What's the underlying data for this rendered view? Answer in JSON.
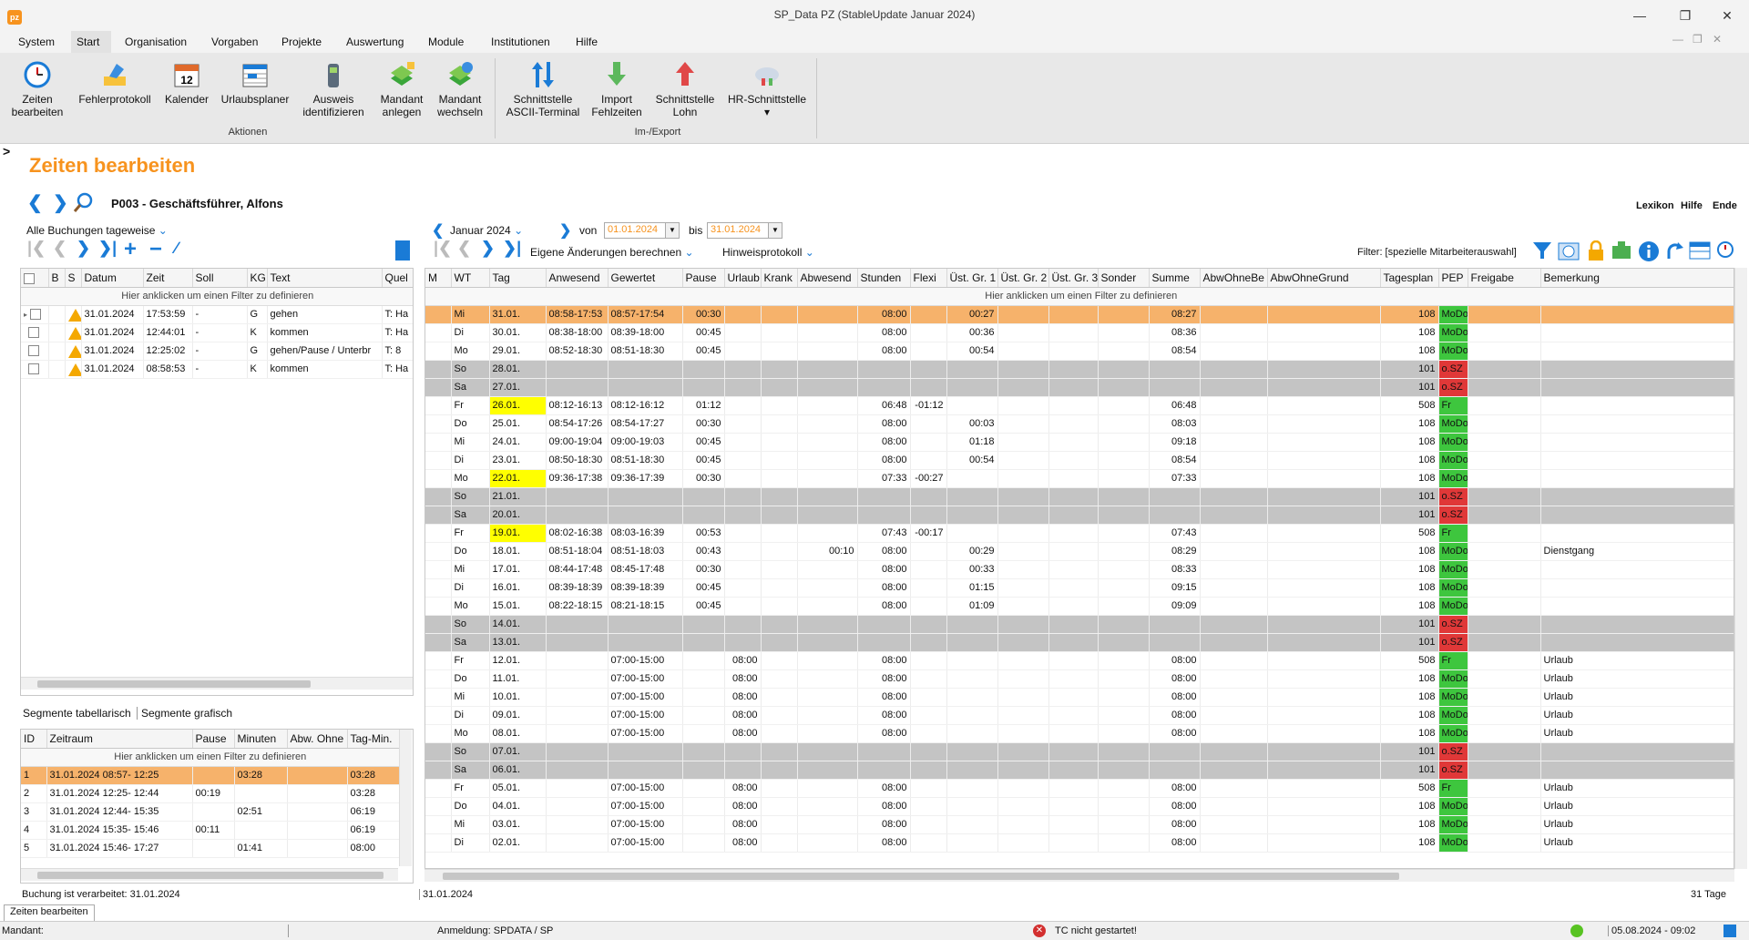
{
  "window": {
    "title": "SP_Data PZ (StableUpdate Januar 2024)",
    "logo": "pz"
  },
  "menu": [
    "System",
    "Start",
    "Organisation",
    "Vorgaben",
    "Projekte",
    "Auswertung",
    "Module",
    "Institutionen",
    "Hilfe"
  ],
  "ribbon": {
    "buttons": [
      {
        "l1": "Zeiten",
        "l2": "bearbeiten",
        "icon": "clock-icon"
      },
      {
        "l1": "Fehlerprotokoll",
        "l2": "",
        "icon": "error-log-icon"
      },
      {
        "l1": "Kalender",
        "l2": "",
        "icon": "calendar-icon"
      },
      {
        "l1": "Urlaubsplaner",
        "l2": "",
        "icon": "vacation-planner-icon"
      },
      {
        "l1": "Ausweis",
        "l2": "identifizieren",
        "icon": "badge-reader-icon"
      },
      {
        "l1": "Mandant",
        "l2": "anlegen",
        "icon": "client-add-icon"
      },
      {
        "l1": "Mandant",
        "l2": "wechseln",
        "icon": "client-switch-icon"
      },
      {
        "l1": "Schnittstelle",
        "l2": "ASCII-Terminal",
        "icon": "ascii-terminal-icon"
      },
      {
        "l1": "Import",
        "l2": "Fehlzeiten",
        "icon": "import-icon"
      },
      {
        "l1": "Schnittstelle",
        "l2": "Lohn",
        "icon": "payroll-export-icon"
      },
      {
        "l1": "HR-Schnittstelle",
        "l2": "▾",
        "icon": "hr-cloud-icon"
      }
    ],
    "groups": [
      "Aktionen",
      "Im-/Export"
    ]
  },
  "page": {
    "title": "Zeiten bearbeiten",
    "employee": "P003 - Geschäftsführer, Alfons",
    "links": [
      "Lexikon",
      "Hilfe",
      "Ende"
    ]
  },
  "left": {
    "mode": "Alle Buchungen tageweise",
    "headers": [
      "B",
      "S",
      "Datum",
      "Zeit",
      "Soll",
      "KG",
      "Text",
      "Quel"
    ],
    "filter": "Hier anklicken um einen Filter zu definieren",
    "rows": [
      {
        "datum": "31.01.2024",
        "zeit": "17:53:59",
        "soll": "-",
        "kg": "G",
        "text": "gehen",
        "quel": "T: Ha"
      },
      {
        "datum": "31.01.2024",
        "zeit": "12:44:01",
        "soll": "-",
        "kg": "K",
        "text": "kommen",
        "quel": "T: Ha"
      },
      {
        "datum": "31.01.2024",
        "zeit": "12:25:02",
        "soll": "-",
        "kg": "G",
        "text": "gehen/Pause / Unterbr",
        "quel": "T: 8"
      },
      {
        "datum": "31.01.2024",
        "zeit": "08:58:53",
        "soll": "-",
        "kg": "K",
        "text": "kommen",
        "quel": "T: Ha"
      }
    ]
  },
  "segments": {
    "tabs": [
      "Segmente tabellarisch",
      "Segmente grafisch"
    ],
    "headers": [
      "ID",
      "Zeitraum",
      "Pause",
      "Minuten",
      "Abw. Ohne",
      "Tag-Min."
    ],
    "filter": "Hier anklicken um einen Filter zu definieren",
    "rows": [
      {
        "id": "1",
        "zeitraum": "31.01.2024  08:57- 12:25",
        "pause": "",
        "minuten": "03:28",
        "abw": "",
        "tag": "03:28"
      },
      {
        "id": "2",
        "zeitraum": "31.01.2024  12:25- 12:44",
        "pause": "00:19",
        "minuten": "",
        "abw": "",
        "tag": "03:28"
      },
      {
        "id": "3",
        "zeitraum": "31.01.2024  12:44- 15:35",
        "pause": "",
        "minuten": "02:51",
        "abw": "",
        "tag": "06:19"
      },
      {
        "id": "4",
        "zeitraum": "31.01.2024  15:35- 15:46",
        "pause": "00:11",
        "minuten": "",
        "abw": "",
        "tag": "06:19"
      },
      {
        "id": "5",
        "zeitraum": "31.01.2024  15:46- 17:27",
        "pause": "",
        "minuten": "01:41",
        "abw": "",
        "tag": "08:00"
      }
    ]
  },
  "main": {
    "month": "Januar 2024",
    "von_label": "von",
    "von": "01.01.2024",
    "bis_label": "bis",
    "bis": "31.01.2024",
    "action": "Eigene Änderungen berechnen",
    "hinweis": "Hinweisprotokoll",
    "filter_label": "Filter: [spezielle Mitarbeiterauswahl]",
    "headers": [
      "M",
      "WT",
      "Tag",
      "Anwesend",
      "Gewertet",
      "Pause",
      "Urlaub",
      "Krank",
      "Abwesend",
      "Stunden",
      "Flexi",
      "Üst. Gr. 1",
      "Üst. Gr. 2",
      "Üst. Gr. 3",
      "Sonder",
      "Summe",
      "AbwOhneBe",
      "AbwOhneGrund",
      "Tagesplan",
      "PEP",
      "Freigabe",
      "Bemerkung"
    ],
    "filter": "Hier anklicken um einen Filter zu definieren",
    "rows": [
      {
        "wt": "Mi",
        "tag": "31.01.",
        "anw": "08:58-17:53",
        "gew": "08:57-17:54",
        "pause": "00:30",
        "url": "",
        "krank": "",
        "abw": "",
        "std": "08:00",
        "flexi": "",
        "u1": "00:27",
        "sum": "08:27",
        "plan": "108",
        "pep": "MoDo",
        "bem": "",
        "cls": "sel",
        "ty": ""
      },
      {
        "wt": "Di",
        "tag": "30.01.",
        "anw": "08:38-18:00",
        "gew": "08:39-18:00",
        "pause": "00:45",
        "url": "",
        "krank": "",
        "abw": "",
        "std": "08:00",
        "flexi": "",
        "u1": "00:36",
        "sum": "08:36",
        "plan": "108",
        "pep": "MoDo",
        "bem": "",
        "cls": "",
        "ty": ""
      },
      {
        "wt": "Mo",
        "tag": "29.01.",
        "anw": "08:52-18:30",
        "gew": "08:51-18:30",
        "pause": "00:45",
        "url": "",
        "krank": "",
        "abw": "",
        "std": "08:00",
        "flexi": "",
        "u1": "00:54",
        "sum": "08:54",
        "plan": "108",
        "pep": "MoDo",
        "bem": "",
        "cls": "",
        "ty": ""
      },
      {
        "wt": "So",
        "tag": "28.01.",
        "anw": "",
        "gew": "",
        "pause": "",
        "url": "",
        "krank": "",
        "abw": "",
        "std": "",
        "flexi": "",
        "u1": "",
        "sum": "",
        "plan": "101",
        "pep": "o.SZ",
        "bem": "",
        "cls": "weekend",
        "ty": ""
      },
      {
        "wt": "Sa",
        "tag": "27.01.",
        "anw": "",
        "gew": "",
        "pause": "",
        "url": "",
        "krank": "",
        "abw": "",
        "std": "",
        "flexi": "",
        "u1": "",
        "sum": "",
        "plan": "101",
        "pep": "o.SZ",
        "bem": "",
        "cls": "weekend",
        "ty": ""
      },
      {
        "wt": "Fr",
        "tag": "26.01.",
        "anw": "08:12-16:13",
        "gew": "08:12-16:12",
        "pause": "01:12",
        "url": "",
        "krank": "",
        "abw": "",
        "std": "06:48",
        "flexi": "-01:12",
        "u1": "",
        "sum": "06:48",
        "plan": "508",
        "pep": "Fr",
        "bem": "",
        "cls": "",
        "ty": "y"
      },
      {
        "wt": "Do",
        "tag": "25.01.",
        "anw": "08:54-17:26",
        "gew": "08:54-17:27",
        "pause": "00:30",
        "url": "",
        "krank": "",
        "abw": "",
        "std": "08:00",
        "flexi": "",
        "u1": "00:03",
        "sum": "08:03",
        "plan": "108",
        "pep": "MoDo",
        "bem": "",
        "cls": "",
        "ty": ""
      },
      {
        "wt": "Mi",
        "tag": "24.01.",
        "anw": "09:00-19:04",
        "gew": "09:00-19:03",
        "pause": "00:45",
        "url": "",
        "krank": "",
        "abw": "",
        "std": "08:00",
        "flexi": "",
        "u1": "01:18",
        "sum": "09:18",
        "plan": "108",
        "pep": "MoDo",
        "bem": "",
        "cls": "",
        "ty": ""
      },
      {
        "wt": "Di",
        "tag": "23.01.",
        "anw": "08:50-18:30",
        "gew": "08:51-18:30",
        "pause": "00:45",
        "url": "",
        "krank": "",
        "abw": "",
        "std": "08:00",
        "flexi": "",
        "u1": "00:54",
        "sum": "08:54",
        "plan": "108",
        "pep": "MoDo",
        "bem": "",
        "cls": "",
        "ty": ""
      },
      {
        "wt": "Mo",
        "tag": "22.01.",
        "anw": "09:36-17:38",
        "gew": "09:36-17:39",
        "pause": "00:30",
        "url": "",
        "krank": "",
        "abw": "",
        "std": "07:33",
        "flexi": "-00:27",
        "u1": "",
        "sum": "07:33",
        "plan": "108",
        "pep": "MoDo",
        "bem": "",
        "cls": "",
        "ty": "y"
      },
      {
        "wt": "So",
        "tag": "21.01.",
        "anw": "",
        "gew": "",
        "pause": "",
        "url": "",
        "krank": "",
        "abw": "",
        "std": "",
        "flexi": "",
        "u1": "",
        "sum": "",
        "plan": "101",
        "pep": "o.SZ",
        "bem": "",
        "cls": "weekend",
        "ty": ""
      },
      {
        "wt": "Sa",
        "tag": "20.01.",
        "anw": "",
        "gew": "",
        "pause": "",
        "url": "",
        "krank": "",
        "abw": "",
        "std": "",
        "flexi": "",
        "u1": "",
        "sum": "",
        "plan": "101",
        "pep": "o.SZ",
        "bem": "",
        "cls": "weekend",
        "ty": ""
      },
      {
        "wt": "Fr",
        "tag": "19.01.",
        "anw": "08:02-16:38",
        "gew": "08:03-16:39",
        "pause": "00:53",
        "url": "",
        "krank": "",
        "abw": "",
        "std": "07:43",
        "flexi": "-00:17",
        "u1": "",
        "sum": "07:43",
        "plan": "508",
        "pep": "Fr",
        "bem": "",
        "cls": "",
        "ty": "y"
      },
      {
        "wt": "Do",
        "tag": "18.01.",
        "anw": "08:51-18:04",
        "gew": "08:51-18:03",
        "pause": "00:43",
        "url": "",
        "krank": "",
        "abw": "00:10",
        "std": "08:00",
        "flexi": "",
        "u1": "00:29",
        "sum": "08:29",
        "plan": "108",
        "pep": "MoDo",
        "bem": "Dienstgang",
        "cls": "",
        "ty": ""
      },
      {
        "wt": "Mi",
        "tag": "17.01.",
        "anw": "08:44-17:48",
        "gew": "08:45-17:48",
        "pause": "00:30",
        "url": "",
        "krank": "",
        "abw": "",
        "std": "08:00",
        "flexi": "",
        "u1": "00:33",
        "sum": "08:33",
        "plan": "108",
        "pep": "MoDo",
        "bem": "",
        "cls": "",
        "ty": ""
      },
      {
        "wt": "Di",
        "tag": "16.01.",
        "anw": "08:39-18:39",
        "gew": "08:39-18:39",
        "pause": "00:45",
        "url": "",
        "krank": "",
        "abw": "",
        "std": "08:00",
        "flexi": "",
        "u1": "01:15",
        "sum": "09:15",
        "plan": "108",
        "pep": "MoDo",
        "bem": "",
        "cls": "",
        "ty": ""
      },
      {
        "wt": "Mo",
        "tag": "15.01.",
        "anw": "08:22-18:15",
        "gew": "08:21-18:15",
        "pause": "00:45",
        "url": "",
        "krank": "",
        "abw": "",
        "std": "08:00",
        "flexi": "",
        "u1": "01:09",
        "sum": "09:09",
        "plan": "108",
        "pep": "MoDo",
        "bem": "",
        "cls": "",
        "ty": ""
      },
      {
        "wt": "So",
        "tag": "14.01.",
        "anw": "",
        "gew": "",
        "pause": "",
        "url": "",
        "krank": "",
        "abw": "",
        "std": "",
        "flexi": "",
        "u1": "",
        "sum": "",
        "plan": "101",
        "pep": "o.SZ",
        "bem": "",
        "cls": "weekend",
        "ty": ""
      },
      {
        "wt": "Sa",
        "tag": "13.01.",
        "anw": "",
        "gew": "",
        "pause": "",
        "url": "",
        "krank": "",
        "abw": "",
        "std": "",
        "flexi": "",
        "u1": "",
        "sum": "",
        "plan": "101",
        "pep": "o.SZ",
        "bem": "",
        "cls": "weekend",
        "ty": ""
      },
      {
        "wt": "Fr",
        "tag": "12.01.",
        "anw": "",
        "gew": "07:00-15:00",
        "pause": "",
        "url": "08:00",
        "krank": "",
        "abw": "",
        "std": "08:00",
        "flexi": "",
        "u1": "",
        "sum": "08:00",
        "plan": "508",
        "pep": "Fr",
        "bem": "Urlaub",
        "cls": "",
        "ty": ""
      },
      {
        "wt": "Do",
        "tag": "11.01.",
        "anw": "",
        "gew": "07:00-15:00",
        "pause": "",
        "url": "08:00",
        "krank": "",
        "abw": "",
        "std": "08:00",
        "flexi": "",
        "u1": "",
        "sum": "08:00",
        "plan": "108",
        "pep": "MoDo",
        "bem": "Urlaub",
        "cls": "",
        "ty": ""
      },
      {
        "wt": "Mi",
        "tag": "10.01.",
        "anw": "",
        "gew": "07:00-15:00",
        "pause": "",
        "url": "08:00",
        "krank": "",
        "abw": "",
        "std": "08:00",
        "flexi": "",
        "u1": "",
        "sum": "08:00",
        "plan": "108",
        "pep": "MoDo",
        "bem": "Urlaub",
        "cls": "",
        "ty": ""
      },
      {
        "wt": "Di",
        "tag": "09.01.",
        "anw": "",
        "gew": "07:00-15:00",
        "pause": "",
        "url": "08:00",
        "krank": "",
        "abw": "",
        "std": "08:00",
        "flexi": "",
        "u1": "",
        "sum": "08:00",
        "plan": "108",
        "pep": "MoDo",
        "bem": "Urlaub",
        "cls": "",
        "ty": ""
      },
      {
        "wt": "Mo",
        "tag": "08.01.",
        "anw": "",
        "gew": "07:00-15:00",
        "pause": "",
        "url": "08:00",
        "krank": "",
        "abw": "",
        "std": "08:00",
        "flexi": "",
        "u1": "",
        "sum": "08:00",
        "plan": "108",
        "pep": "MoDo",
        "bem": "Urlaub",
        "cls": "",
        "ty": ""
      },
      {
        "wt": "So",
        "tag": "07.01.",
        "anw": "",
        "gew": "",
        "pause": "",
        "url": "",
        "krank": "",
        "abw": "",
        "std": "",
        "flexi": "",
        "u1": "",
        "sum": "",
        "plan": "101",
        "pep": "o.SZ",
        "bem": "",
        "cls": "weekend",
        "ty": ""
      },
      {
        "wt": "Sa",
        "tag": "06.01.",
        "anw": "",
        "gew": "",
        "pause": "",
        "url": "",
        "krank": "",
        "abw": "",
        "std": "",
        "flexi": "",
        "u1": "",
        "sum": "",
        "plan": "101",
        "pep": "o.SZ",
        "bem": "",
        "cls": "weekend",
        "ty": ""
      },
      {
        "wt": "Fr",
        "tag": "05.01.",
        "anw": "",
        "gew": "07:00-15:00",
        "pause": "",
        "url": "08:00",
        "krank": "",
        "abw": "",
        "std": "08:00",
        "flexi": "",
        "u1": "",
        "sum": "08:00",
        "plan": "508",
        "pep": "Fr",
        "bem": "Urlaub",
        "cls": "",
        "ty": ""
      },
      {
        "wt": "Do",
        "tag": "04.01.",
        "anw": "",
        "gew": "07:00-15:00",
        "pause": "",
        "url": "08:00",
        "krank": "",
        "abw": "",
        "std": "08:00",
        "flexi": "",
        "u1": "",
        "sum": "08:00",
        "plan": "108",
        "pep": "MoDo",
        "bem": "Urlaub",
        "cls": "",
        "ty": ""
      },
      {
        "wt": "Mi",
        "tag": "03.01.",
        "anw": "",
        "gew": "07:00-15:00",
        "pause": "",
        "url": "08:00",
        "krank": "",
        "abw": "",
        "std": "08:00",
        "flexi": "",
        "u1": "",
        "sum": "08:00",
        "plan": "108",
        "pep": "MoDo",
        "bem": "Urlaub",
        "cls": "",
        "ty": ""
      },
      {
        "wt": "Di",
        "tag": "02.01.",
        "anw": "",
        "gew": "07:00-15:00",
        "pause": "",
        "url": "08:00",
        "krank": "",
        "abw": "",
        "std": "08:00",
        "flexi": "",
        "u1": "",
        "sum": "08:00",
        "plan": "108",
        "pep": "MoDo",
        "bem": "Urlaub",
        "cls": "",
        "ty": ""
      }
    ]
  },
  "status": {
    "left": "Buchung ist verarbeitet: 31.01.2024",
    "mid": "31.01.2024",
    "right": "31 Tage",
    "tab": "Zeiten bearbeiten",
    "mandant": "Mandant:",
    "anmeldung": "Anmeldung:  SPDATA / SP",
    "tc": "TC nicht gestartet!",
    "datetime": "05.08.2024 - 09:02"
  }
}
